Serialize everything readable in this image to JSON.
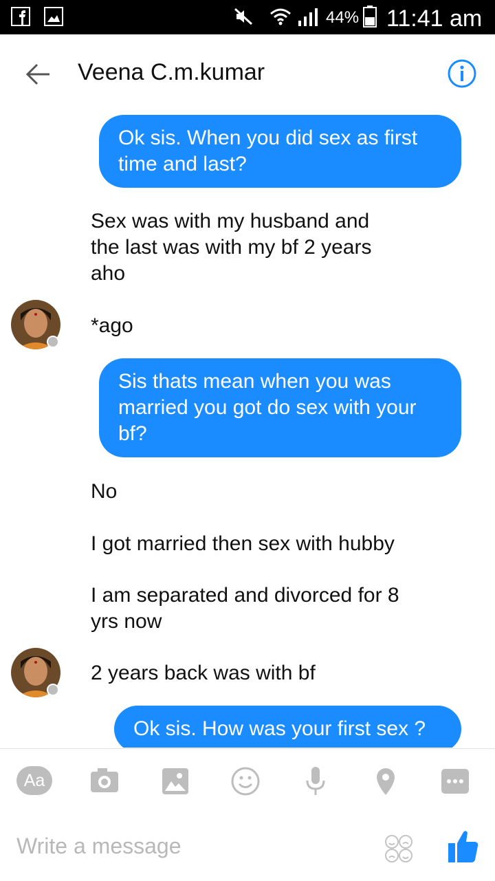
{
  "status_bar": {
    "battery": "44%",
    "time": "11:41 am"
  },
  "header": {
    "contact_name": "Veena C.m.kumar"
  },
  "messages": [
    {
      "dir": "out",
      "text": "Ok sis. When you did sex as first time and last?"
    },
    {
      "dir": "in",
      "text": "Sex was with my husband and the last was with my bf 2 years aho"
    },
    {
      "dir": "in",
      "text": "*ago"
    },
    {
      "dir": "out",
      "text": "Sis thats mean when you was married you got do sex with your bf?"
    },
    {
      "dir": "in",
      "text": "No"
    },
    {
      "dir": "in",
      "text": "I got married then sex with hubby"
    },
    {
      "dir": "in",
      "text": "I am separated and divorced for 8 yrs now"
    },
    {
      "dir": "in",
      "text": "2 years back was with bf"
    },
    {
      "dir": "out",
      "text": "Ok sis. How was your first sex ?"
    }
  ],
  "composer": {
    "text_button": "Aa",
    "placeholder": "Write a message",
    "icons": [
      "camera-icon",
      "image-icon",
      "emoji-icon",
      "microphone-icon",
      "location-icon",
      "more-icon",
      "sticker-icon",
      "like-icon"
    ]
  },
  "colors": {
    "accent": "#1a8cff",
    "icon_gray": "#bdbdbd",
    "status_bar": "#000000"
  }
}
